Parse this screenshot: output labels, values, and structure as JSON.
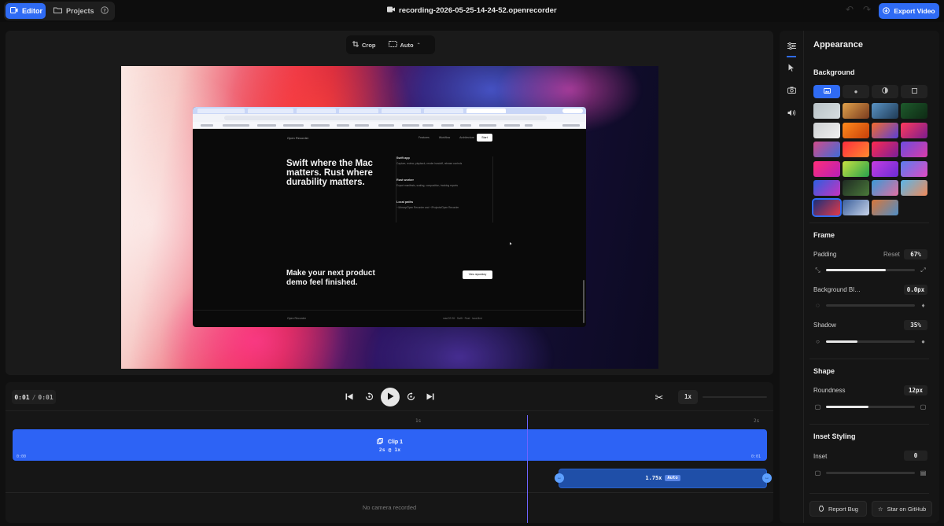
{
  "topbar": {
    "editor_label": "Editor",
    "projects_label": "Projects",
    "help_icon": "question-circle-icon",
    "document_title": "recording-2026-05-25-14-24-52.openrecorder",
    "export_label": "Export Video",
    "accent": "#2f6bf4"
  },
  "preview": {
    "crop_label": "Crop",
    "aspect_label": "Auto",
    "site": {
      "brand": "Open Recorder",
      "nav": [
        "Features",
        "Workflow",
        "Architecture"
      ],
      "start_label": "Start",
      "headline": "Swift where the Mac matters. Rust where durability matters.",
      "features": [
        {
          "title": "Swift app",
          "desc": "Capture, review, playback, render handoff, release controls"
        },
        {
          "title": "Rust worker",
          "desc": "Export manifests, scaling, composition, tracking reports"
        },
        {
          "title": "Local paths",
          "desc": "~/Library/Open Recorder and ~/Projects/Open Recorder"
        }
      ],
      "cta_headline": "Make your next product demo feel finished.",
      "cta_label": "View repository",
      "footer_left": "Open Recorder",
      "footer_right": "macOS 26 · Swift · Rust · local-first"
    }
  },
  "timeline": {
    "current_time": "0:01",
    "separator": "/",
    "duration": "0:01",
    "speed_label": "1x",
    "ruler_marks": [
      "1s",
      "2s"
    ],
    "clip": {
      "title": "Clip 1",
      "subtitle": "2s @ 1x",
      "start": "0:00",
      "end": "0:01"
    },
    "zoom": {
      "label": "1.75x",
      "badge": "Auto"
    },
    "camera_placeholder": "No camera recorded"
  },
  "settings": {
    "panel_title": "Appearance",
    "background": {
      "title": "Background",
      "tabs": [
        "image-icon",
        "color-icon",
        "gradient-icon",
        "blank-icon"
      ],
      "swatches": [
        [
          "#b9c3c7",
          "#d6dde0"
        ],
        [
          "#e0a14b",
          "#7a3b1e"
        ],
        [
          "#5a93c4",
          "#1f3b56"
        ],
        [
          "#1e5a2c",
          "#0e2a14"
        ],
        [
          "#cfd2d4",
          "#efefef"
        ],
        [
          "#ff8a1c",
          "#c8400a"
        ],
        [
          "#f36a2d",
          "#5a3fd6"
        ],
        [
          "#ff3a5c",
          "#7b1c8f"
        ],
        [
          "#d14c8a",
          "#3f6bd8"
        ],
        [
          "#ff2e3e",
          "#ff8a2e"
        ],
        [
          "#ff2a4f",
          "#7a1f9c"
        ],
        [
          "#6d4ce0",
          "#d93ca8"
        ],
        [
          "#ff2e78",
          "#b81fb8"
        ],
        [
          "#c7e041",
          "#27a24c"
        ],
        [
          "#c43de0",
          "#6b2cd6"
        ],
        [
          "#5a7df0",
          "#e04ac2"
        ],
        [
          "#2d5fe0",
          "#c832c0"
        ],
        [
          "#1f2b23",
          "#4a7a3a"
        ],
        [
          "#3a9ad6",
          "#e06fa2"
        ],
        [
          "#5ab6e8",
          "#f08a5a"
        ],
        [
          "#1a2f7a",
          "#e23a4a"
        ],
        [
          "#3a5f9c",
          "#c7d3e8"
        ],
        [
          "#d8763a",
          "#4f8ec6"
        ]
      ],
      "selected_index": 20
    },
    "frame": {
      "title": "Frame",
      "padding_label": "Padding",
      "reset_label": "Reset",
      "padding_value": "67%",
      "padding_level": 0.67,
      "blur_label": "Background Bl…",
      "blur_value": "0.0px",
      "blur_level": 0.0,
      "shadow_label": "Shadow",
      "shadow_value": "35%",
      "shadow_level": 0.35
    },
    "shape": {
      "title": "Shape",
      "roundness_label": "Roundness",
      "roundness_value": "12px",
      "roundness_level": 0.48
    },
    "inset": {
      "title": "Inset Styling",
      "inset_label": "Inset",
      "inset_value": "0",
      "inset_level": 0.0
    },
    "footer": {
      "report_label": "Report Bug",
      "star_label": "Star on GitHub"
    }
  }
}
